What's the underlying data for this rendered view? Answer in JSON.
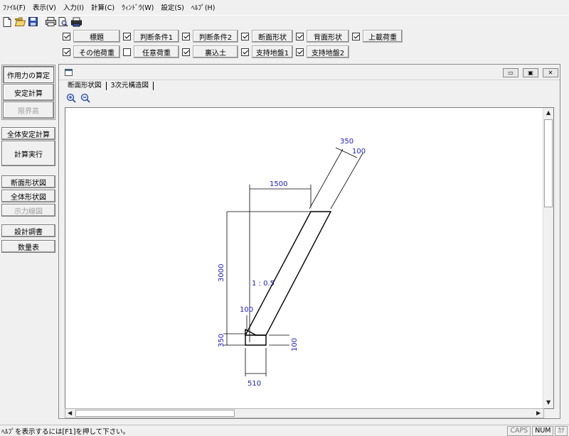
{
  "menu": [
    "ﾌｧｲﾙ(F)",
    "表示(V)",
    "入力(I)",
    "計算(C)",
    "ｳｨﾝﾄﾞｳ(W)",
    "設定(S)",
    "ﾍﾙﾌﾟ(H)"
  ],
  "toolbar": {
    "icons": [
      "new-file-icon",
      "open-folder-icon",
      "save-icon",
      "print-icon",
      "print-preview-icon",
      "printer-setup-icon"
    ]
  },
  "checks": {
    "row1": [
      {
        "label": "標題",
        "checked": true
      },
      {
        "label": "判断条件1",
        "checked": true
      },
      {
        "label": "判断条件2",
        "checked": true
      },
      {
        "label": "断面形状",
        "checked": true
      },
      {
        "label": "背面形状",
        "checked": true
      },
      {
        "label": "上載荷重",
        "checked": true
      }
    ],
    "row2": [
      {
        "label": "その他荷重",
        "checked": true
      },
      {
        "label": "任意荷重",
        "checked": false
      },
      {
        "label": "裏込土",
        "checked": true
      },
      {
        "label": "支持地盤1",
        "checked": true
      },
      {
        "label": "支持地盤2",
        "checked": true
      }
    ]
  },
  "left": {
    "group1": [
      "作用力の算定",
      "安定計算",
      "限界高"
    ],
    "overall": "全体安定計算",
    "run": "計算実行",
    "views": [
      "断面形状図",
      "全体形状図",
      "示力線図"
    ],
    "docs": [
      "設計調書",
      "数量表"
    ]
  },
  "window": {
    "buttons": {
      "minimize": "▭",
      "restore": "▣",
      "close": "✕"
    },
    "tabs": [
      "断面形状図",
      "3次元構造図"
    ]
  },
  "drawing": {
    "dims": {
      "top_width": "1500",
      "top_thickness": "350",
      "top_thickness_small": "100",
      "height": "3000",
      "slope": "1 : 0.5",
      "toe_height": "350",
      "toe_top": "100",
      "toe_right": "100",
      "base_width": "510"
    },
    "line_color": "#000000",
    "dim_color": "#1a1acc"
  },
  "status": {
    "text": "ﾍﾙﾌﾟを表示するには[F1]を押して下さい。",
    "indicators": [
      {
        "label": "CAPS",
        "on": false
      },
      {
        "label": "NUM",
        "on": true
      },
      {
        "label": "ｶﾅ",
        "on": false
      }
    ]
  }
}
